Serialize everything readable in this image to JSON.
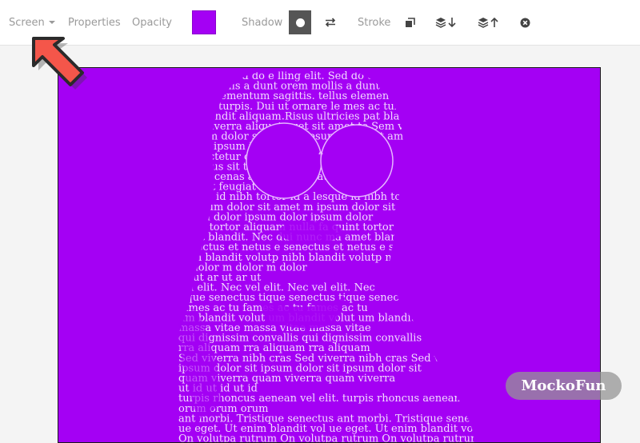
{
  "toolbar": {
    "screen_label": "Screen",
    "properties_label": "Properties",
    "opacity_label": "Opacity",
    "fill_color": "#a400f4",
    "shadow_label": "Shadow",
    "stroke_label": "Stroke"
  },
  "icons": {
    "dropdown": "chevron-down-icon",
    "shadow_toggle": "circle-icon",
    "swap": "swap-arrows-icon",
    "duplicate": "duplicate-icon",
    "layer_down": "layers-down-icon",
    "layer_up": "layers-up-icon",
    "close": "close-circle-icon"
  },
  "canvas": {
    "background_color": "#a400f4",
    "text_lines": [
      "lling elit. Sed do e",
      "orem mollis a dunt",
      "tellus elementum sagittis.",
      "mes ac turpis. Dui ut ornare le",
      "pat blandit aliquam.Risus ultricies",
      "Sem viverra aliquet eget sit amet te",
      "t ipsum dolor sit amet",
      "ipsum",
      "consectetur",
      "sit tellus",
      "at maecenas",
      "feugiat",
      "lesque id nibh tortor id a",
      "m ipsum dolor sit amet",
      "ipsum dolor",
      "quint tortor aliquam nulla fa",
      "amet blandit. Nec dui nunc ma",
      "senectus et netus e",
      "nibh blandit volutp",
      "m dolor",
      "ar ut",
      "vel elit. Nec",
      "tique senectus",
      "fames ac tu",
      "um blandit volut",
      "massa vitae",
      "qui dignissim convallis",
      "rra aliquam",
      "Sed viverra nibh cras",
      "ipsum dolor sit",
      "quam viverra",
      "ut id",
      "turpis rhoncus aenean vel elit.",
      "orum",
      "ant morbi. Tristique senectus",
      "ue eget. Ut enim blandit vol",
      "On volutpa rutrum"
    ]
  },
  "watermark": {
    "text": "MockoFun"
  }
}
